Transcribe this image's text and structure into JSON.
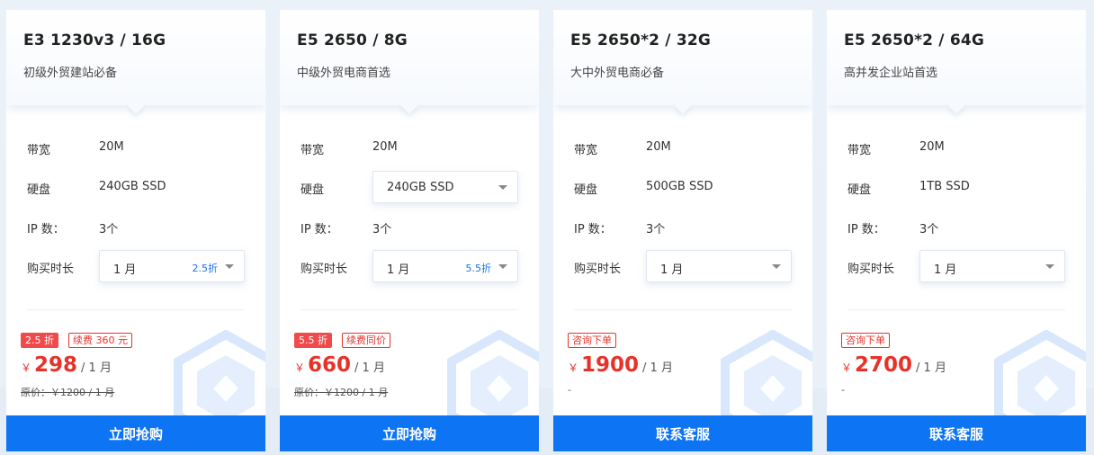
{
  "labels": {
    "bandwidth": "带宽",
    "disk": "硬盘",
    "ip": "IP 数：",
    "duration": "购买时长"
  },
  "cards": [
    {
      "title": "E3 1230v3 / 16G",
      "subtitle": "初级外贸建站必备",
      "bandwidth": "20M",
      "disk": "240GB SSD",
      "ip_count": "3个",
      "duration": "1 月",
      "duration_discount": "2.5折",
      "badge_primary": "2.5 折",
      "badge_secondary": "续费 360 元",
      "currency": "￥",
      "price": "298",
      "per": "/ 1 月",
      "original": "原价：￥1200 / 1 月",
      "cta": "立即抢购"
    },
    {
      "title": "E5 2650 / 8G",
      "subtitle": "中级外贸电商首选",
      "bandwidth": "20M",
      "disk": "240GB SSD",
      "ip_count": "3个",
      "duration": "1 月",
      "duration_discount": "5.5折",
      "badge_primary": "5.5 折",
      "badge_secondary": "续费同价",
      "currency": "￥",
      "price": "660",
      "per": "/ 1 月",
      "original": "原价：￥1200 / 1 月",
      "cta": "立即抢购"
    },
    {
      "title": "E5 2650*2 / 32G",
      "subtitle": "大中外贸电商必备",
      "bandwidth": "20M",
      "disk": "500GB SSD",
      "ip_count": "3个",
      "duration": "1 月",
      "badge_secondary": "咨询下单",
      "currency": "￥",
      "price": "1900",
      "per": "/ 1 月",
      "original": "-",
      "cta": "联系客服"
    },
    {
      "title": "E5 2650*2 / 64G",
      "subtitle": "高并发企业站首选",
      "bandwidth": "20M",
      "disk": "1TB SSD",
      "ip_count": "3个",
      "duration": "1 月",
      "badge_secondary": "咨询下单",
      "currency": "￥",
      "price": "2700",
      "per": "/ 1 月",
      "original": "-",
      "cta": "联系客服"
    }
  ],
  "colors": {
    "accent": "#0d74f4",
    "price": "#e6332a",
    "badge": "#f04a4a"
  },
  "icons": {
    "select_caret": "caret-down-icon",
    "decor": "hexagon-decor-icon"
  }
}
